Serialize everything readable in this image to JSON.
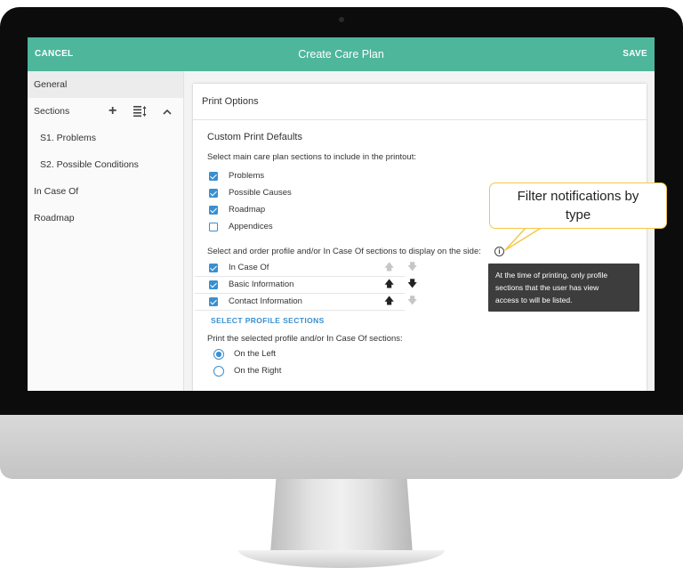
{
  "topbar": {
    "cancel_label": "CANCEL",
    "title": "Create Care Plan",
    "save_label": "SAVE"
  },
  "sidebar": {
    "items": [
      {
        "label": "General"
      },
      {
        "label": "Sections"
      },
      {
        "label": "S1. Problems"
      },
      {
        "label": "S2. Possible Conditions"
      },
      {
        "label": "In Case Of"
      },
      {
        "label": "Roadmap"
      }
    ],
    "controls": {
      "add_icon": "plus-icon",
      "reorder_icon": "reorder-list-icon",
      "collapse_icon": "chevron-up-icon"
    }
  },
  "print_options": {
    "header": "Print Options",
    "custom_title": "Custom Print Defaults",
    "sections_prompt": "Select main care plan sections to include in the printout:",
    "main_sections": [
      {
        "label": "Problems",
        "checked": true
      },
      {
        "label": "Possible Causes",
        "checked": true
      },
      {
        "label": "Roadmap",
        "checked": true
      },
      {
        "label": "Appendices",
        "checked": false
      }
    ],
    "order_prompt": "Select and order profile and/or In Case Of sections to display on the side:",
    "profile_sections": [
      {
        "label": "In Case Of",
        "checked": true,
        "up": "disabled",
        "down": "disabled"
      },
      {
        "label": "Basic Information",
        "checked": true,
        "up": "enabled",
        "down": "enabled"
      },
      {
        "label": "Contact Information",
        "checked": true,
        "up": "enabled",
        "down": "disabled"
      }
    ],
    "select_profile_link": "SELECT PROFILE SECTIONS",
    "position_prompt": "Print the selected profile and/or In Case Of sections:",
    "position_options": [
      {
        "label": "On the Left",
        "selected": true
      },
      {
        "label": "On the Right",
        "selected": false
      }
    ]
  },
  "tooltip": {
    "line1": "At the time of printing, only profile",
    "line2": "sections that the user has view",
    "line3": "access to will be listed."
  },
  "callout": {
    "line1": "Filter notifications by",
    "line2": "type"
  },
  "colors": {
    "header_green": "#4db69b",
    "accent_blue": "#3a8fd0",
    "callout_border": "#f4c74a",
    "tooltip_bg": "#3d3d3d"
  }
}
